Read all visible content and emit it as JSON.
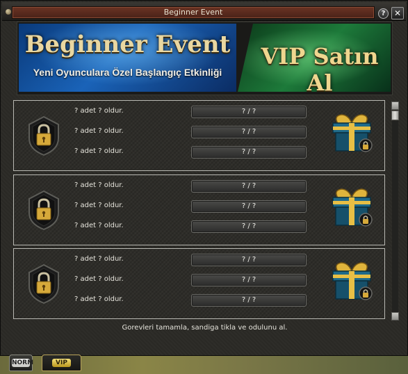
{
  "window": {
    "title": "Beginner Event",
    "help_label": "?",
    "close_label": "✕"
  },
  "banners": {
    "left_title": "Beginner Event",
    "left_subtitle": "Yeni Oyunculara Özel Başlangıç Etkinliği",
    "right_title": "VIP Satın Al"
  },
  "rows": [
    {
      "tasks": [
        {
          "text": "? adet ? oldur.",
          "progress": "? / ?"
        },
        {
          "text": "? adet ? oldur.",
          "progress": "? / ?"
        },
        {
          "text": "? adet ? oldur.",
          "progress": "? / ?"
        }
      ],
      "lock_icon": "lock-shield-icon",
      "reward_icon": "gift-box-locked-icon"
    },
    {
      "tasks": [
        {
          "text": "? adet ? oldur.",
          "progress": "? / ?"
        },
        {
          "text": "? adet ? oldur.",
          "progress": "? / ?"
        },
        {
          "text": "? adet ? oldur.",
          "progress": "? / ?"
        }
      ],
      "lock_icon": "lock-shield-icon",
      "reward_icon": "gift-box-locked-icon"
    },
    {
      "tasks": [
        {
          "text": "? adet ? oldur.",
          "progress": "? / ?"
        },
        {
          "text": "? adet ? oldur.",
          "progress": "? / ?"
        },
        {
          "text": "? adet ? oldur.",
          "progress": "? / ?"
        }
      ],
      "lock_icon": "lock-shield-icon",
      "reward_icon": "gift-box-locked-icon"
    }
  ],
  "footer_note": "Gorevleri tamamla, sandiga tikla ve odulunu al.",
  "tabs": {
    "norm_label": "NORM",
    "vip_label": "VIP"
  },
  "colors": {
    "title_bar": "#5a2c1e",
    "vip_gold": "#e2c35a",
    "banner_blue": "#1a63b8",
    "banner_green": "#1d7a3a"
  }
}
